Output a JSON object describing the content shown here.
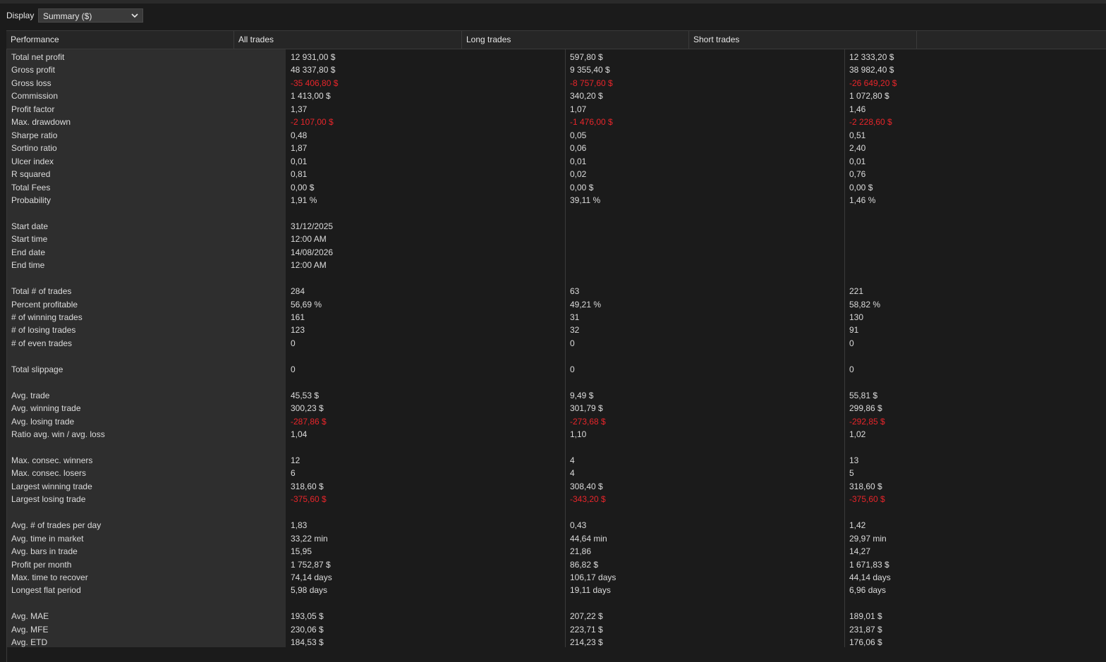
{
  "toolbar": {
    "display_label": "Display",
    "display_value": "Summary ($)"
  },
  "colors": {
    "negative": "#e8252a",
    "background": "#1b1b1b",
    "label_column": "#2e2e2e"
  },
  "table": {
    "headers": [
      "Performance",
      "All trades",
      "Long trades",
      "Short trades"
    ],
    "rows": [
      {
        "label": "Total net profit",
        "all": "12 931,00 $",
        "long": "597,80 $",
        "short": "12 333,20 $"
      },
      {
        "label": "Gross profit",
        "all": "48 337,80 $",
        "long": "9 355,40 $",
        "short": "38 982,40 $"
      },
      {
        "label": "Gross loss",
        "all": "-35 406,80 $",
        "long": "-8 757,60 $",
        "short": "-26 649,20 $",
        "negative": true
      },
      {
        "label": "Commission",
        "all": "1 413,00 $",
        "long": "340,20 $",
        "short": "1 072,80 $"
      },
      {
        "label": "Profit factor",
        "all": "1,37",
        "long": "1,07",
        "short": "1,46"
      },
      {
        "label": "Max. drawdown",
        "all": "-2 107,00 $",
        "long": "-1 476,00 $",
        "short": "-2 228,60 $",
        "negative": true
      },
      {
        "label": "Sharpe ratio",
        "all": "0,48",
        "long": "0,05",
        "short": "0,51"
      },
      {
        "label": "Sortino ratio",
        "all": "1,87",
        "long": "0,06",
        "short": "2,40"
      },
      {
        "label": "Ulcer index",
        "all": "0,01",
        "long": "0,01",
        "short": "0,01"
      },
      {
        "label": "R squared",
        "all": "0,81",
        "long": "0,02",
        "short": "0,76"
      },
      {
        "label": "Total Fees",
        "all": "0,00 $",
        "long": "0,00 $",
        "short": "0,00 $"
      },
      {
        "label": "Probability",
        "all": "1,91 %",
        "long": "39,11 %",
        "short": "1,46 %"
      },
      {
        "label": "",
        "all": "",
        "long": "",
        "short": ""
      },
      {
        "label": "Start date",
        "all": "31/12/2025",
        "long": "",
        "short": ""
      },
      {
        "label": "Start time",
        "all": "12:00 AM",
        "long": "",
        "short": ""
      },
      {
        "label": "End date",
        "all": "14/08/2026",
        "long": "",
        "short": ""
      },
      {
        "label": "End time",
        "all": "12:00 AM",
        "long": "",
        "short": ""
      },
      {
        "label": "",
        "all": "",
        "long": "",
        "short": ""
      },
      {
        "label": "Total # of trades",
        "all": "284",
        "long": "63",
        "short": "221"
      },
      {
        "label": "Percent profitable",
        "all": "56,69 %",
        "long": "49,21 %",
        "short": "58,82 %"
      },
      {
        "label": "# of winning trades",
        "all": "161",
        "long": "31",
        "short": "130"
      },
      {
        "label": "# of losing trades",
        "all": "123",
        "long": "32",
        "short": "91"
      },
      {
        "label": "# of even trades",
        "all": "0",
        "long": "0",
        "short": "0"
      },
      {
        "label": "",
        "all": "",
        "long": "",
        "short": ""
      },
      {
        "label": "Total slippage",
        "all": "0",
        "long": "0",
        "short": "0"
      },
      {
        "label": "",
        "all": "",
        "long": "",
        "short": ""
      },
      {
        "label": "Avg. trade",
        "all": "45,53 $",
        "long": "9,49 $",
        "short": "55,81 $"
      },
      {
        "label": "Avg. winning trade",
        "all": "300,23 $",
        "long": "301,79 $",
        "short": "299,86 $"
      },
      {
        "label": "Avg. losing trade",
        "all": "-287,86 $",
        "long": "-273,68 $",
        "short": "-292,85 $",
        "negative": true
      },
      {
        "label": "Ratio avg. win / avg. loss",
        "all": "1,04",
        "long": "1,10",
        "short": "1,02"
      },
      {
        "label": "",
        "all": "",
        "long": "",
        "short": ""
      },
      {
        "label": "Max. consec. winners",
        "all": "12",
        "long": "4",
        "short": "13"
      },
      {
        "label": "Max. consec. losers",
        "all": "6",
        "long": "4",
        "short": "5"
      },
      {
        "label": "Largest winning trade",
        "all": "318,60 $",
        "long": "308,40 $",
        "short": "318,60 $"
      },
      {
        "label": "Largest losing trade",
        "all": "-375,60 $",
        "long": "-343,20 $",
        "short": "-375,60 $",
        "negative": true
      },
      {
        "label": "",
        "all": "",
        "long": "",
        "short": ""
      },
      {
        "label": "Avg. # of trades per day",
        "all": "1,83",
        "long": "0,43",
        "short": "1,42"
      },
      {
        "label": "Avg. time in market",
        "all": "33,22 min",
        "long": "44,64 min",
        "short": "29,97 min"
      },
      {
        "label": "Avg. bars in trade",
        "all": "15,95",
        "long": "21,86",
        "short": "14,27"
      },
      {
        "label": "Profit per month",
        "all": "1 752,87 $",
        "long": "86,82 $",
        "short": "1 671,83 $"
      },
      {
        "label": "Max. time to recover",
        "all": "74,14 days",
        "long": "106,17 days",
        "short": "44,14 days"
      },
      {
        "label": "Longest flat period",
        "all": "5,98 days",
        "long": "19,11 days",
        "short": "6,96 days"
      },
      {
        "label": "",
        "all": "",
        "long": "",
        "short": ""
      },
      {
        "label": "Avg. MAE",
        "all": "193,05 $",
        "long": "207,22 $",
        "short": "189,01 $"
      },
      {
        "label": "Avg. MFE",
        "all": "230,06 $",
        "long": "223,71 $",
        "short": "231,87 $"
      },
      {
        "label": "Avg. ETD",
        "all": "184,53 $",
        "long": "214,23 $",
        "short": "176,06 $"
      }
    ]
  }
}
